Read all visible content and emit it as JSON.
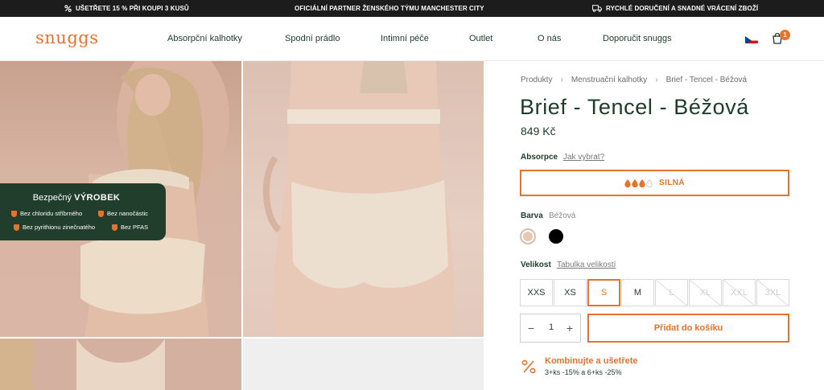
{
  "promo": {
    "left": "UŠETŘETE 15 % PŘI KOUPI 3 KUSŮ",
    "center": "OFICIÁLNÍ PARTNER ŽENSKÉHO TÝMU MANCHESTER CITY",
    "right": "RYCHLÉ DORUČENÍ A SNADNÉ VRÁCENÍ ZBOŽÍ"
  },
  "header": {
    "logo": "snuggs",
    "nav": [
      "Absorpční kalhotky",
      "Spodní prádlo",
      "Intimní péče",
      "Outlet",
      "O nás",
      "Doporučit snuggs"
    ],
    "cart_count": "1"
  },
  "badge": {
    "title_light": "Bezpečný",
    "title_bold": "VÝROBEK",
    "items": [
      "Bez chloridu stříbrného",
      "Bez nanočástic",
      "Bez pyrithionu zinečnatého",
      "Bez PFAS"
    ]
  },
  "product": {
    "breadcrumb": [
      "Produkty",
      "Menstruační kalhotky",
      "Brief - Tencel - Béžová"
    ],
    "title": "Brief - Tencel - Béžová",
    "price": "849 Kč",
    "absorption_label": "Absorpce",
    "absorption_link": "Jak vybrat?",
    "absorption_value": "SILNÁ",
    "absorption_level": 3,
    "absorption_max": 4,
    "color_label": "Barva",
    "color_value": "Béžová",
    "colors": [
      "#e6c8b4",
      "#000000"
    ],
    "size_label": "Velikost",
    "size_link": "Tabulka velikostí",
    "sizes": [
      "XXS",
      "XS",
      "S",
      "M",
      "L",
      "XL",
      "XXL",
      "3XL"
    ],
    "selected_size": "S",
    "unavailable_sizes": [
      "L",
      "XL",
      "XXL",
      "3XL"
    ],
    "quantity": "1",
    "qty_minus": "−",
    "qty_plus": "+",
    "add_to_cart": "Přidat do košíku",
    "combo_title": "Kombinujte a ušetřete",
    "combo_sub": "3+ks -15% a 6+ks -25%"
  },
  "colors": {
    "accent": "#e8722c",
    "dark_green": "#213d2c"
  }
}
